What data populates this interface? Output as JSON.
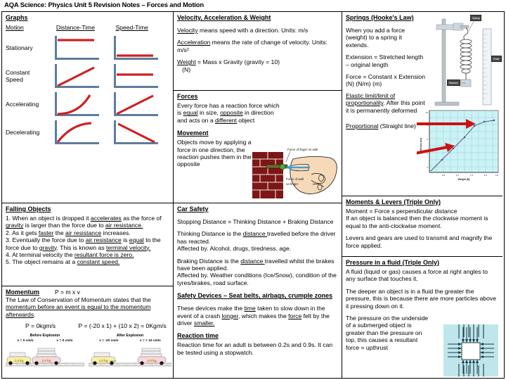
{
  "doc": {
    "title": "AQA Science: Physics Unit 5 Revision Notes – Forces and Motion"
  },
  "colors": {
    "graph_axis": "#5b7d9e",
    "graph_line": "#cc2222",
    "arrow_red": "#cc1111",
    "brick": "#8b1a1a",
    "fluid_bg": "#bfe6ea",
    "grid_cyan": "#7fd6e0"
  },
  "graphs": {
    "heading": "Graphs",
    "columns": [
      "Motion",
      "Distance-Time",
      "Speed-Time"
    ],
    "rows": [
      {
        "motion": "Stationary",
        "dt": "flat-high",
        "st": "flat-low"
      },
      {
        "motion": "Constant\nSpeed",
        "dt": "straight-up",
        "st": "flat-mid"
      },
      {
        "motion": "Accelerating",
        "dt": "curve-up",
        "st": "straight-up"
      },
      {
        "motion": "Decelerating",
        "dt": "curve-flatten",
        "st": "straight-down"
      }
    ]
  },
  "falling": {
    "heading": "Falling Objects",
    "points": [
      "1. When an object is dropped it accelerates as the force of gravity is larger than the force due to air resistance.",
      "2. As it gets faster the air resistance increases.",
      "3. Eventually the force due to air resistance is equal to the force due to gravity. This is known as terminal velocity.",
      "4. At terminal velocity the resultant force is zero.",
      "5. The object remains at a constant speed."
    ]
  },
  "momentum": {
    "heading": "Momentum",
    "formula": "P = m x v",
    "law": "The Law of Conservation of Momentum states that the momentum before an event is equal to the momentum afterwards.",
    "before": {
      "p_label": "P = 0kgm/s",
      "caption": "Before Explosion",
      "cart_left": {
        "v": "v = 0 cm/s",
        "mass": "1.0 kg"
      },
      "cart_right": {
        "v": "v = 0 cm/s",
        "mass": "2.0 kg"
      }
    },
    "after": {
      "p_label": "P = (-20 x 1) + (10 x 2) = 0Kgm/s",
      "caption": "After Explosion",
      "cart_left": {
        "v": "v = -20 cm/s",
        "mass": "1.0 kg"
      },
      "cart_right": {
        "v": "v = + 10 cm/s",
        "mass": "2.0 kg"
      }
    }
  },
  "vaw": {
    "heading": "Velocity, Acceleration & Weight",
    "velocity": "Velocity means speed with a direction. Units: m/s",
    "velocity_term": "Velocity",
    "acceleration": "Acceleration means the rate of change of velocity. Units: m/s²",
    "acceleration_term": "Acceleration",
    "weight": "Weight = Mass x Gravity (gravity = 10)",
    "weight_term": "Weight",
    "weight_units": "(N)"
  },
  "forces": {
    "heading": "Forces",
    "text": "Every force has a reaction force which is equal in size, opposite in direction and acts on a different object",
    "movement_heading": "Movement",
    "movement_text": "Objects move by applying a force in one direction, the reaction pushes them in the opposite",
    "figure": {
      "label_top": "Force of finger on wall",
      "label_bottom": "Force of wall on finger"
    }
  },
  "carsafety": {
    "heading": "Car Safety",
    "stopping": "Stopping Distance = Thinking Distance + Braking Distance",
    "thinking": "Thinking Distance is the distance travelled before the driver has reacted.",
    "thinking_affected": "Affected by. Alcohol, drugs, tiredness, age.",
    "braking": "Braking Distance is the distance travelled whilst the brakes have been applied.",
    "braking_affected": "Affected by. Weather conditions (Ice/Snow), condition of the tyres/brakes, road surface.",
    "devices_heading": "Safety Devices – Seat belts, airbags, crumple zones",
    "devices_text": "These devices make the time taken to slow down in the event of a crash longer, which makes the force felt by the driver smaller.",
    "reaction_heading": "Reaction time",
    "reaction_text": "Reaction time for an adult is between 0.2s and 0.9s. It can be tested using a stopwatch."
  },
  "springs": {
    "heading": "Springs (Hooke's Law)",
    "intro": "When you add a force (weight) to a spring it extends.",
    "extension": "Extension = Stretched length – original length",
    "force_eq": "Force = Constant x Extension",
    "force_units": "(N)        (N/m)        (m)",
    "elastic_heading": "Elastic limit/limit of proportionality.",
    "elastic_text": "After this point it is permanently deformed",
    "proportional": "Proportional (Straight line)",
    "apparatus_labels": [
      "Spring",
      "Ruler",
      "Masses"
    ],
    "graph": {
      "ylabel": "Extension (cm)",
      "xlabel": "Weight (N)",
      "xticks": [
        "0.5",
        "1.0",
        "1.5",
        "2.0",
        "2.5"
      ],
      "yticks": [
        "2",
        "4",
        "6",
        "8",
        "10"
      ]
    }
  },
  "moments": {
    "heading": "Moments & Levers (Triple Only)",
    "line1": "Moment = Force x perpendicular distance",
    "line2": "If an object is balanced then the clockwise moment is equal to the anti-clockwise moment.",
    "line3": "Levers and gears are used to transmit and magnify the force applied."
  },
  "pressure": {
    "heading": "Pressure in a fluid (Triple Only)",
    "line1": "A fluid (liquid or gas) causes a force at right angles to any surface that touches it.",
    "line2": "The deeper an object is in a fluid the greater the pressure, this is because there are more particles above it pressing down on it.",
    "line3": "The pressure on the underside of a submerged object is greater than the pressure on top, this causes a resultant force = upthrust"
  }
}
